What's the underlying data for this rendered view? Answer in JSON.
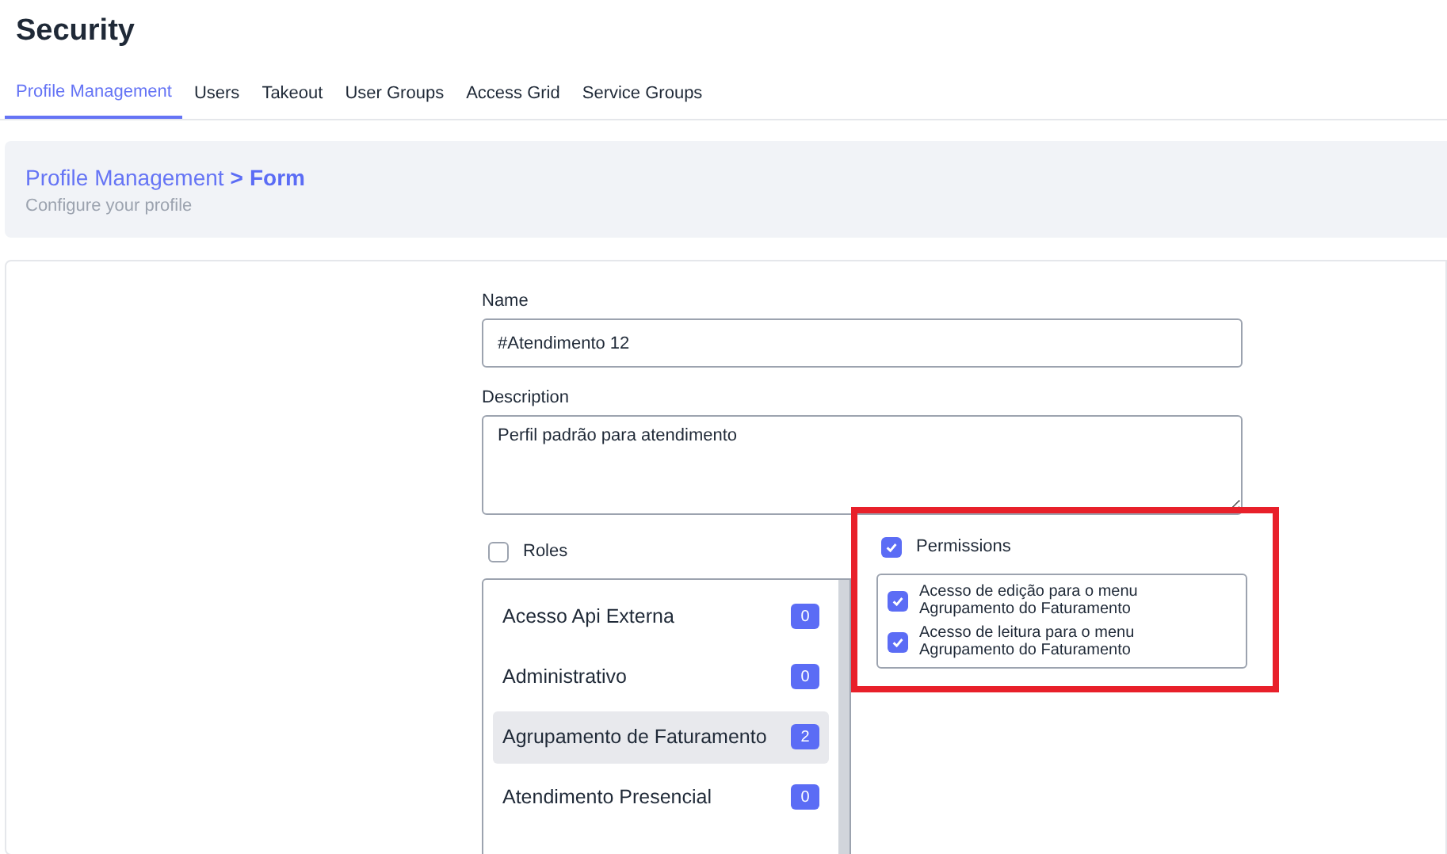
{
  "page_title": "Security",
  "tabs": [
    {
      "label": "Profile Management",
      "selected": true
    },
    {
      "label": "Users",
      "selected": false
    },
    {
      "label": "Takeout",
      "selected": false
    },
    {
      "label": "User Groups",
      "selected": false
    },
    {
      "label": "Access Grid",
      "selected": false
    },
    {
      "label": "Service Groups",
      "selected": false
    }
  ],
  "breadcrumb": {
    "parent": "Profile Management",
    "separator": ">",
    "current": "Form",
    "subtitle": "Configure your profile"
  },
  "form": {
    "name_label": "Name",
    "name_value": "#Atendimento 12",
    "description_label": "Description",
    "description_value": "Perfil padrão para atendimento"
  },
  "roles": {
    "label": "Roles",
    "checked": false,
    "items": [
      {
        "label": "Acesso Api Externa",
        "count": "0",
        "selected": false
      },
      {
        "label": "Administrativo",
        "count": "0",
        "selected": false
      },
      {
        "label": "Agrupamento de Faturamento",
        "count": "2",
        "selected": true
      },
      {
        "label": "Atendimento Presencial",
        "count": "0",
        "selected": false
      }
    ]
  },
  "permissions": {
    "label": "Permissions",
    "checked": true,
    "highlighted": true,
    "items": [
      {
        "label": "Acesso de edição para o menu Agrupamento do Faturamento",
        "checked": true
      },
      {
        "label": "Acesso de leitura para o menu Agrupamento do Faturamento",
        "checked": true
      }
    ]
  }
}
